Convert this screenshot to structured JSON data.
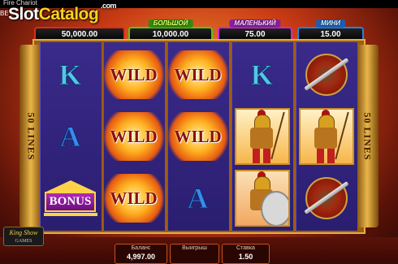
{
  "window": {
    "title": "Fire Chariot"
  },
  "watermark": {
    "slot": "Slot",
    "catalog": "Catalog",
    "com": ".com"
  },
  "bet_label": "BE",
  "jackpots": [
    {
      "label": "",
      "value": "50,000.00",
      "color": "#e02a1a"
    },
    {
      "label": "БОЛЬШОЙ",
      "value": "10,000.00",
      "color": "#5bc416"
    },
    {
      "label": "МАЛЕНЬКИЙ",
      "value": "75.00",
      "color": "#cc2ad0"
    },
    {
      "label": "МИНИ",
      "value": "15.00",
      "color": "#2a80e0"
    }
  ],
  "lines_label": "50 LINES",
  "reels": [
    [
      "K",
      "A",
      "BONUS"
    ],
    [
      "WILD",
      "WILD",
      "WILD"
    ],
    [
      "WILD",
      "WILD",
      "A"
    ],
    [
      "K",
      "warrior",
      "warrior-shield"
    ],
    [
      "shield-sword",
      "warrior",
      "shield-sword"
    ]
  ],
  "logo": {
    "name": "King Show",
    "sub": "GAMES"
  },
  "footer": {
    "balance_label": "Баланс",
    "balance_value": "4,997.00",
    "win_label": "Выигрыш",
    "win_value": "",
    "bet_label": "Ставка",
    "bet_value": "1.50"
  }
}
